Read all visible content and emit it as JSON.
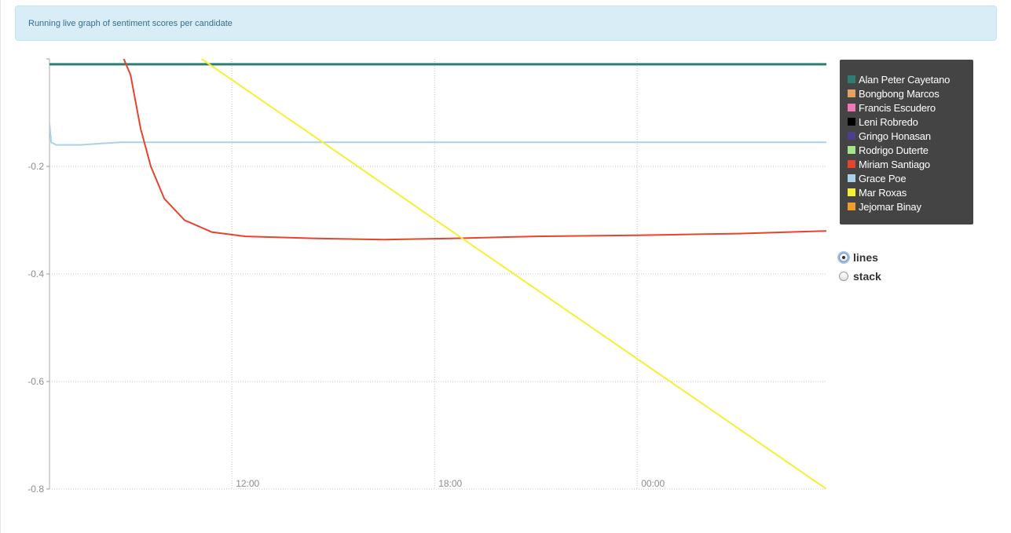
{
  "alert": {
    "text": "Running live graph of sentiment scores per candidate"
  },
  "legend": {
    "items": [
      {
        "label": "Alan Peter Cayetano",
        "color": "#2e7d73"
      },
      {
        "label": "Bongbong Marcos",
        "color": "#e8a060"
      },
      {
        "label": "Francis Escudero",
        "color": "#ee78b8"
      },
      {
        "label": "Leni Robredo",
        "color": "#000000"
      },
      {
        "label": "Gringo Honasan",
        "color": "#4b3f8f"
      },
      {
        "label": "Rodrigo Duterte",
        "color": "#a4e58a"
      },
      {
        "label": "Miriam Santiago",
        "color": "#e8432d"
      },
      {
        "label": "Grace Poe",
        "color": "#a9d2ea"
      },
      {
        "label": "Mar Roxas",
        "color": "#f5ef35"
      },
      {
        "label": "Jejomar Binay",
        "color": "#f29c2a"
      }
    ]
  },
  "controls": {
    "options": [
      {
        "label": "lines",
        "checked": true
      },
      {
        "label": "stack",
        "checked": false
      }
    ]
  },
  "chart_data": {
    "type": "line",
    "x_tick_labels": [
      "12:00",
      "18:00",
      "00:00"
    ],
    "x_tick_hours": [
      12,
      18,
      24
    ],
    "x_range_hours": [
      6.6,
      29.6
    ],
    "y_ticks": [
      -0.2,
      -0.4,
      -0.6,
      -0.8
    ],
    "ylim": [
      -0.8,
      0.0
    ],
    "grid": true,
    "legend_position": "right",
    "series": [
      {
        "name": "Alan Peter Cayetano",
        "color": "#2e7d73",
        "points": [
          [
            6.6,
            -0.01
          ],
          [
            29.6,
            -0.01
          ]
        ]
      },
      {
        "name": "Grace Poe",
        "color": "#a9d2ea",
        "points": [
          [
            6.6,
            -0.12
          ],
          [
            6.65,
            -0.155
          ],
          [
            6.8,
            -0.16
          ],
          [
            7.5,
            -0.16
          ],
          [
            8.7,
            -0.155
          ],
          [
            29.6,
            -0.155
          ]
        ]
      },
      {
        "name": "Miriam Santiago",
        "color": "#e8432d",
        "points": [
          [
            8.8,
            0.0
          ],
          [
            9.0,
            -0.03
          ],
          [
            9.3,
            -0.13
          ],
          [
            9.6,
            -0.2
          ],
          [
            10.0,
            -0.26
          ],
          [
            10.6,
            -0.3
          ],
          [
            11.4,
            -0.322
          ],
          [
            12.4,
            -0.33
          ],
          [
            14.5,
            -0.334
          ],
          [
            16.5,
            -0.336
          ],
          [
            18.5,
            -0.334
          ],
          [
            21.0,
            -0.33
          ],
          [
            24.0,
            -0.328
          ],
          [
            27.0,
            -0.325
          ],
          [
            29.6,
            -0.32
          ]
        ]
      },
      {
        "name": "Mar Roxas",
        "color": "#f5ef35",
        "points": [
          [
            11.1,
            0.0
          ],
          [
            29.6,
            -0.8
          ]
        ]
      }
    ]
  }
}
